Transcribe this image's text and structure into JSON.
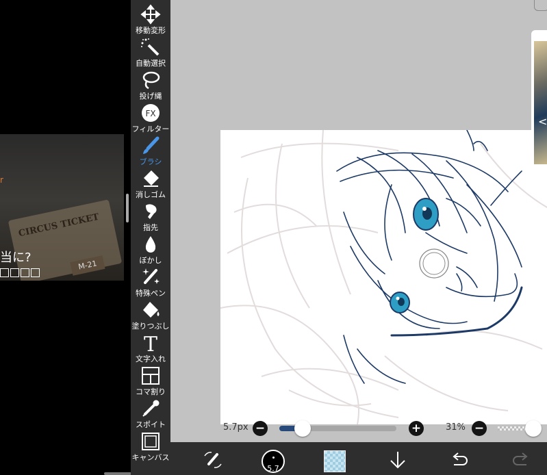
{
  "video_overlay": {
    "caption": "当に?",
    "ticket_text": "CIRCUS  TICKET",
    "ticket_number": "M-21",
    "caption_accent": "r"
  },
  "toolbar": {
    "tools": [
      {
        "id": "move",
        "label": "移動変形",
        "icon": "move-arrows-icon"
      },
      {
        "id": "magic-wand",
        "label": "自動選択",
        "icon": "magic-wand-icon"
      },
      {
        "id": "lasso",
        "label": "投げ縄",
        "icon": "lasso-icon"
      },
      {
        "id": "filter",
        "label": "フィルター",
        "icon": "fx-icon",
        "icon_text": "FX"
      },
      {
        "id": "brush",
        "label": "ブラシ",
        "icon": "brush-icon",
        "active": true
      },
      {
        "id": "eraser",
        "label": "消しゴム",
        "icon": "eraser-icon"
      },
      {
        "id": "smudge",
        "label": "指先",
        "icon": "finger-icon"
      },
      {
        "id": "blur",
        "label": "ぼかし",
        "icon": "drop-icon"
      },
      {
        "id": "special-pen",
        "label": "特殊ペン",
        "icon": "sparkle-pen-icon"
      },
      {
        "id": "fill",
        "label": "塗りつぶし",
        "icon": "bucket-icon"
      },
      {
        "id": "text",
        "label": "文字入れ",
        "icon": "text-icon",
        "icon_text": "T"
      },
      {
        "id": "frame",
        "label": "コマ割り",
        "icon": "panel-icon"
      },
      {
        "id": "eyedropper",
        "label": "スポイト",
        "icon": "eyedropper-icon"
      },
      {
        "id": "canvas",
        "label": "キャンバス",
        "icon": "canvas-icon"
      }
    ]
  },
  "sliders": {
    "brush_size_label": "5.7px",
    "brush_size_fraction": 0.2,
    "minus": "−",
    "plus": "+",
    "opacity_label": "31%",
    "opacity_fraction": 1.0
  },
  "bottom_bar": {
    "brush_size_badge": "5.7",
    "items": [
      "tool-switch-icon",
      "brush-size-button",
      "color-swatch",
      "download-arrow-icon",
      "undo-icon",
      "redo-icon"
    ]
  },
  "colors": {
    "toolbar_bg": "#2e2e2e",
    "active_tool": "#4a95e6",
    "canvas_bg": "#c2c2c2",
    "line_art": "#1d3a66",
    "eye_color": "#2f9ec4",
    "slider_fill": "#274a7a"
  }
}
